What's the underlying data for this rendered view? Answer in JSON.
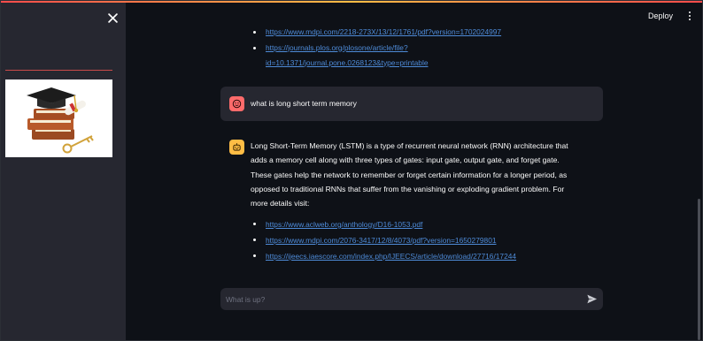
{
  "sidebar": {
    "close_icon": "close-icon",
    "logo_icon": "graduation-cap-books-icon"
  },
  "header": {
    "deploy_label": "Deploy",
    "menu_icon": "kebab-menu-icon"
  },
  "chat": {
    "previous_links": [
      "https://www.mdpi.com/2218-273X/13/12/1761/pdf?version=1702024997",
      "https://journals.plos.org/plosone/article/file?",
      "id=10.1371/journal.pone.0268123&type=printable"
    ],
    "user_message": "what is long short term memory",
    "user_avatar_icon": "smiley-face-icon",
    "assistant_avatar_icon": "robot-face-icon",
    "assistant_lines": [
      "Long Short-Term Memory (LSTM) is a type of recurrent neural network (RNN) architecture that",
      "adds a memory cell along with three types of gates: input gate, output gate, and forget gate.",
      "These gates help the network to remember or forget certain information for a longer period, as",
      "opposed to traditional RNNs that suffer from the vanishing or exploding gradient problem. For",
      "more details visit:"
    ],
    "assistant_links": [
      "https://www.aclweb.org/anthology/D16-1053.pdf",
      "https://www.mdpi.com/2076-3417/12/8/4073/pdf?version=1650279801",
      "https://ijeecs.iaescore.com/index.php/IJEECS/article/download/27716/17244"
    ]
  },
  "input": {
    "placeholder": "What is up?",
    "value": "",
    "send_icon": "send-arrow-icon"
  },
  "colors": {
    "sidebar_bg": "#262730",
    "main_bg": "#0e1117",
    "link": "#4e8bd8",
    "user_avatar": "#ff6b6b",
    "assistant_avatar": "#ffbd45",
    "accent_line": "#c94a4a"
  }
}
